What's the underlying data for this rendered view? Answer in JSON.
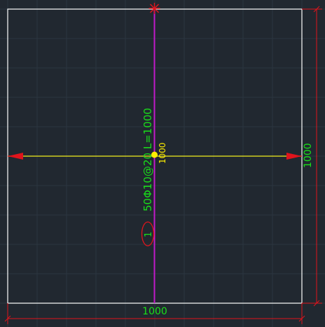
{
  "drawing": {
    "rebar_label": "50Φ10@20 L=1000",
    "rebar_number": "1",
    "center_width_label": "1000",
    "bottom_dimension": "1000",
    "right_dimension": "1000"
  },
  "colors": {
    "background": "#212830",
    "grid": "#2c3640",
    "outline": "#ffffff",
    "rebar_line": "#c11ac9",
    "span_line": "#f4ef1c",
    "arrow": "#e0141c",
    "dimension_line": "#e0141c",
    "text_green": "#19e019",
    "node_yellow": "#ffee00",
    "marker_red": "#e0141c"
  },
  "icons": {
    "top_marker": "asterisk-snap-icon",
    "center_node": "node-dot-icon",
    "left_arrow": "arrow-left-icon",
    "right_arrow": "arrow-right-icon"
  }
}
